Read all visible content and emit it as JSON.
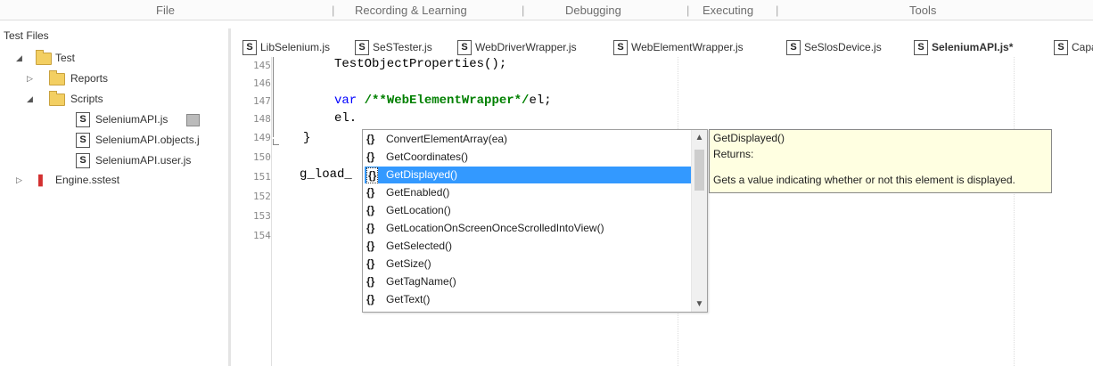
{
  "menu": {
    "file": "File",
    "recording": "Recording & Learning",
    "debugging": "Debugging",
    "executing": "Executing",
    "tools": "Tools"
  },
  "tree": {
    "title": "Test Files",
    "items": [
      {
        "label": "Test",
        "kind": "folder"
      },
      {
        "label": "Reports",
        "kind": "folder"
      },
      {
        "label": "Scripts",
        "kind": "folder"
      },
      {
        "label": "SeleniumAPI.js",
        "kind": "js"
      },
      {
        "label": "SeleniumAPI.objects.j",
        "kind": "js"
      },
      {
        "label": "SeleniumAPI.user.js",
        "kind": "js"
      },
      {
        "label": "Engine.sstest",
        "kind": "engine"
      }
    ]
  },
  "tabs": [
    {
      "label": "LibSelenium.js"
    },
    {
      "label": "SeSTester.js"
    },
    {
      "label": "WebDriverWrapper.js"
    },
    {
      "label": "WebElementWrapper.js"
    },
    {
      "label": "SeSlosDevice.js"
    },
    {
      "label": "SeleniumAPI.js*"
    },
    {
      "label": "Capa"
    }
  ],
  "editor": {
    "line_numbers": [
      "145",
      "146",
      "147",
      "148",
      "149",
      "150",
      "151",
      "152",
      "153",
      "154"
    ],
    "code": {
      "line145": "TestObjectProperties();",
      "line147_kw": "var",
      "line147_comment": "/**WebElementWrapper*/",
      "line147_rest": "el;",
      "line148": "el.",
      "line149": "}",
      "line151": "g_load_"
    }
  },
  "autocomplete": {
    "icon_glyph": "{}",
    "items": [
      "ConvertElementArray(ea)",
      "GetCoordinates()",
      "GetDisplayed()",
      "GetEnabled()",
      "GetLocation()",
      "GetLocationOnScreenOnceScrolledIntoView()",
      "GetSelected()",
      "GetSize()",
      "GetTagName()",
      "GetText()"
    ],
    "selected_index": 2
  },
  "tooltip": {
    "signature": "GetDisplayed()",
    "returns": "Returns:",
    "description": "Gets a value indicating whether or not this element is displayed."
  },
  "colors": {
    "selection": "#3399ff",
    "tooltip_bg": "#ffffe1",
    "keyword": "#0000ff",
    "comment": "#008000"
  }
}
